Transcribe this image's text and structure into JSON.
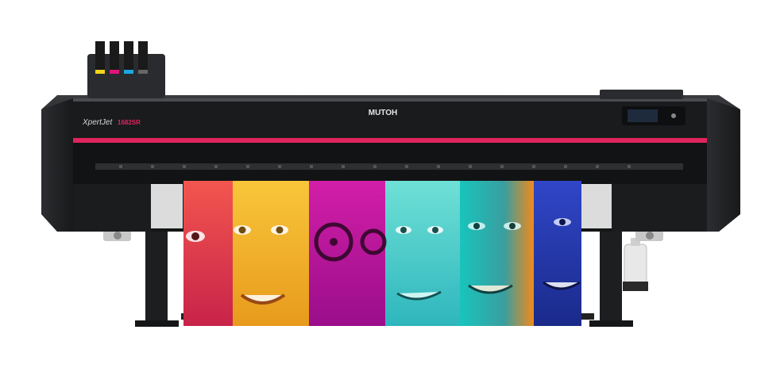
{
  "product": {
    "brand_logo": "MUTOH",
    "model_logo": "XpertJet",
    "model_badge": "1682SR"
  },
  "colors": {
    "body": "#1b1c1e",
    "body_light": "#2b2c2f",
    "accent_stripe": "#e0245e",
    "display_screen": "#1e2b3d",
    "ink_cyan": "#1aa8e0",
    "ink_magenta": "#e0157a",
    "ink_yellow": "#f2d41c",
    "ink_black": "#111111"
  },
  "print_panels": [
    {
      "name": "red-face-panel",
      "color": "#e83a4a"
    },
    {
      "name": "yellow-face-panel",
      "color": "#f4b41e"
    },
    {
      "name": "magenta-face-panel",
      "color": "#c8149a"
    },
    {
      "name": "cyan-face-panel",
      "color": "#4ed0c8"
    },
    {
      "name": "teal-orange-face-panel",
      "color": "#19b8b0"
    },
    {
      "name": "blue-face-panel",
      "color": "#2a3fb8"
    }
  ]
}
